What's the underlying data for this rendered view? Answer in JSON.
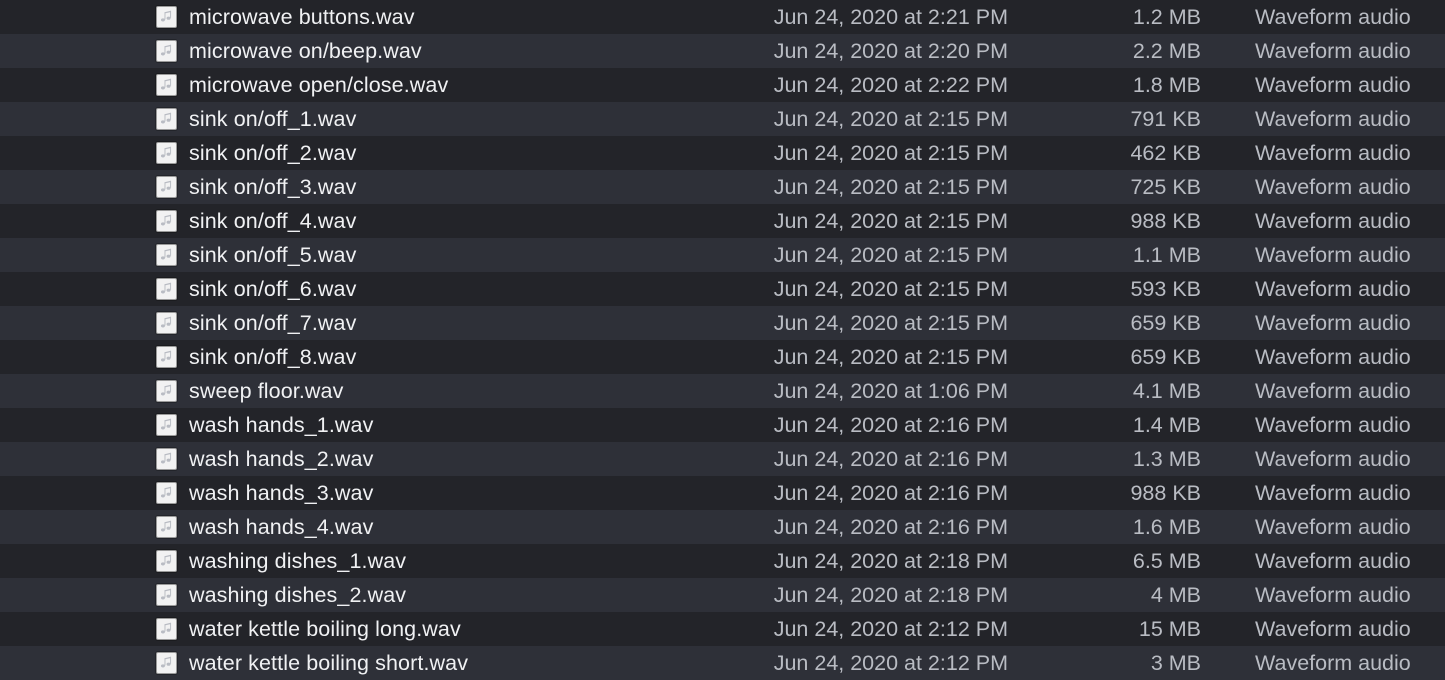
{
  "list": {
    "icon_name": "music-note-file-icon",
    "kind_label": "Waveform audio",
    "rows": [
      {
        "name": "microwave buttons.wav",
        "date": "Jun 24, 2020 at 2:21 PM",
        "size": "1.2 MB",
        "kind": "Waveform audio"
      },
      {
        "name": "microwave on/beep.wav",
        "date": "Jun 24, 2020 at 2:20 PM",
        "size": "2.2 MB",
        "kind": "Waveform audio"
      },
      {
        "name": "microwave open/close.wav",
        "date": "Jun 24, 2020 at 2:22 PM",
        "size": "1.8 MB",
        "kind": "Waveform audio"
      },
      {
        "name": "sink on/off_1.wav",
        "date": "Jun 24, 2020 at 2:15 PM",
        "size": "791 KB",
        "kind": "Waveform audio"
      },
      {
        "name": "sink on/off_2.wav",
        "date": "Jun 24, 2020 at 2:15 PM",
        "size": "462 KB",
        "kind": "Waveform audio"
      },
      {
        "name": "sink on/off_3.wav",
        "date": "Jun 24, 2020 at 2:15 PM",
        "size": "725 KB",
        "kind": "Waveform audio"
      },
      {
        "name": "sink on/off_4.wav",
        "date": "Jun 24, 2020 at 2:15 PM",
        "size": "988 KB",
        "kind": "Waveform audio"
      },
      {
        "name": "sink on/off_5.wav",
        "date": "Jun 24, 2020 at 2:15 PM",
        "size": "1.1 MB",
        "kind": "Waveform audio"
      },
      {
        "name": "sink on/off_6.wav",
        "date": "Jun 24, 2020 at 2:15 PM",
        "size": "593 KB",
        "kind": "Waveform audio"
      },
      {
        "name": "sink on/off_7.wav",
        "date": "Jun 24, 2020 at 2:15 PM",
        "size": "659 KB",
        "kind": "Waveform audio"
      },
      {
        "name": "sink on/off_8.wav",
        "date": "Jun 24, 2020 at 2:15 PM",
        "size": "659 KB",
        "kind": "Waveform audio"
      },
      {
        "name": "sweep floor.wav",
        "date": "Jun 24, 2020 at 1:06 PM",
        "size": "4.1 MB",
        "kind": "Waveform audio"
      },
      {
        "name": "wash hands_1.wav",
        "date": "Jun 24, 2020 at 2:16 PM",
        "size": "1.4 MB",
        "kind": "Waveform audio"
      },
      {
        "name": "wash hands_2.wav",
        "date": "Jun 24, 2020 at 2:16 PM",
        "size": "1.3 MB",
        "kind": "Waveform audio"
      },
      {
        "name": "wash hands_3.wav",
        "date": "Jun 24, 2020 at 2:16 PM",
        "size": "988 KB",
        "kind": "Waveform audio"
      },
      {
        "name": "wash hands_4.wav",
        "date": "Jun 24, 2020 at 2:16 PM",
        "size": "1.6 MB",
        "kind": "Waveform audio"
      },
      {
        "name": "washing dishes_1.wav",
        "date": "Jun 24, 2020 at 2:18 PM",
        "size": "6.5 MB",
        "kind": "Waveform audio"
      },
      {
        "name": "washing dishes_2.wav",
        "date": "Jun 24, 2020 at 2:18 PM",
        "size": "4 MB",
        "kind": "Waveform audio"
      },
      {
        "name": "water kettle boiling long.wav",
        "date": "Jun 24, 2020 at 2:12 PM",
        "size": "15 MB",
        "kind": "Waveform audio"
      },
      {
        "name": "water kettle boiling short.wav",
        "date": "Jun 24, 2020 at 2:12 PM",
        "size": "3 MB",
        "kind": "Waveform audio"
      }
    ]
  },
  "colors": {
    "row_dark": "#232429",
    "row_light": "#2e3038",
    "name_text": "#f0f1f3",
    "meta_text": "#b9bcc3",
    "icon_bg": "#f2f2f2"
  }
}
